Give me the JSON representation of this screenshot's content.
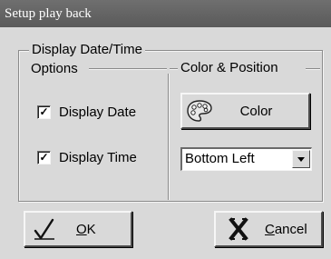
{
  "window": {
    "title": "Setup play back"
  },
  "group": {
    "title": "Display Date/Time"
  },
  "options": {
    "title": "Options",
    "display_date": {
      "label": "Display Date",
      "checked": true
    },
    "display_time": {
      "label": "Display Time",
      "checked": true
    },
    "check_mark": "✓"
  },
  "color_position": {
    "title": "Color & Position",
    "color_button_label": "Color",
    "color_icon": "palette-icon",
    "position_select": {
      "selected": "Bottom Left"
    }
  },
  "footer": {
    "ok": {
      "mnemonic": "O",
      "rest": "K",
      "icon": "checkmark-pen-icon"
    },
    "cancel": {
      "mnemonic": "C",
      "rest": "ancel",
      "icon": "x-cancel-icon"
    }
  }
}
